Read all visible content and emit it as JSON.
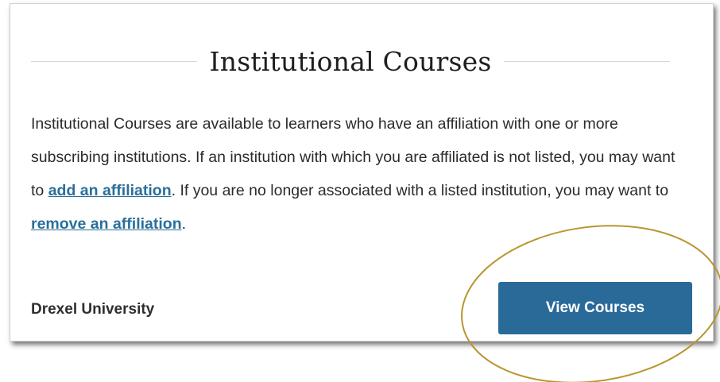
{
  "section": {
    "title": "Institutional Courses",
    "description": {
      "text_1": "Institutional Courses are available to learners who have an affiliation with one or more subscribing institutions. If an institution with which you are affiliated is not listed, you may want to ",
      "link_add": "add an affiliation",
      "text_2": ". If you are no longer associated with a listed institution, you may want to ",
      "link_remove": "remove an affiliation",
      "text_3": "."
    }
  },
  "institutions": [
    {
      "name": "Drexel University",
      "button_label": "View Courses"
    }
  ],
  "colors": {
    "accent": "#2a6a99",
    "link": "#2a6f9a",
    "highlight": "#b8962e"
  }
}
